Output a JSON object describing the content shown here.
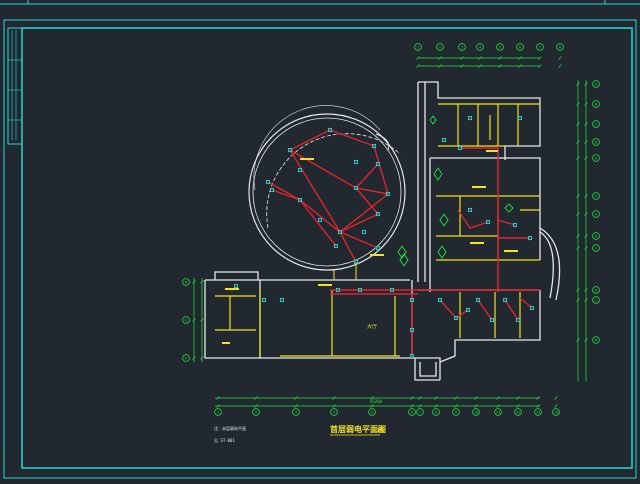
{
  "colors": {
    "background": "#212830",
    "frame": "#27d7d7",
    "wall": "#e8e8e8",
    "partition": "#f2e222",
    "circuit": "#e0242c",
    "device": "#27d7d7",
    "dimension": "#22e53c",
    "label": "#f2e222"
  },
  "drawing": {
    "title": "首层弱电平面图",
    "scale": "1:100",
    "note_line1": "注：本层弱电平面",
    "note_line2": "见 ST-001",
    "central_room_label": "大厅",
    "circle_room_label": "",
    "grid_labels_top": [
      "1",
      "2",
      "3",
      "4",
      "5",
      "6",
      "7",
      "8"
    ],
    "grid_labels_right": [
      "A",
      "B",
      "C",
      "D",
      "E",
      "F",
      "G",
      "H",
      "J",
      "K",
      "L",
      "M"
    ],
    "grid_labels_bottom": [
      "1",
      "2",
      "3",
      "4",
      "5",
      "6",
      "7",
      "8",
      "9",
      "10",
      "11",
      "12",
      "13",
      "14"
    ],
    "grid_labels_left": [
      "D",
      "E",
      "F"
    ],
    "overall_dimension": "43200"
  },
  "icons": {
    "outlet": "data-outlet-icon",
    "junction": "junction-box-icon"
  }
}
